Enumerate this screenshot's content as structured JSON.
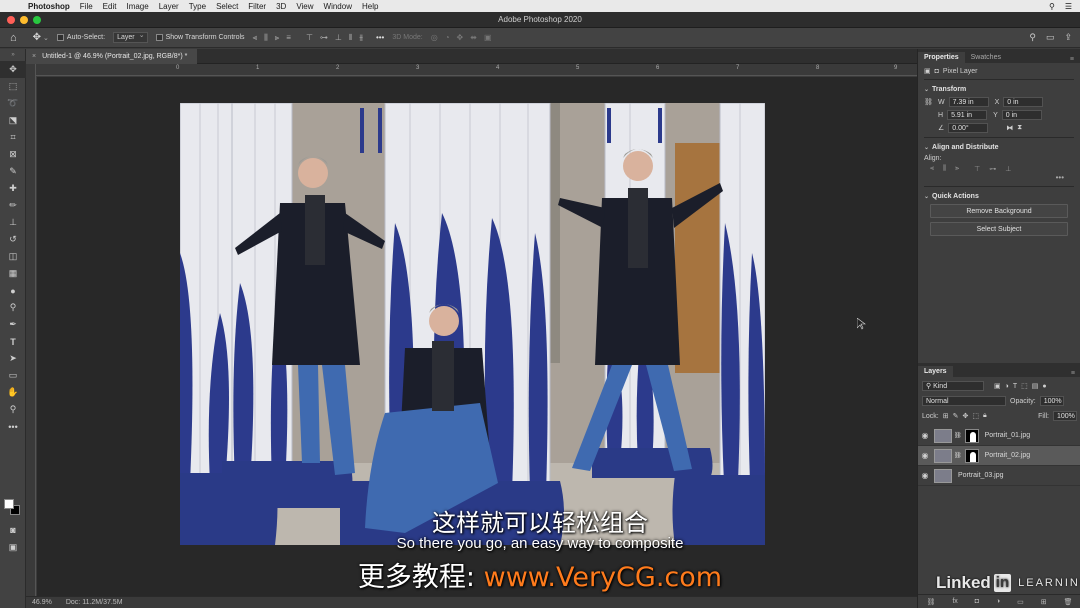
{
  "menubar": {
    "apple": "",
    "app_name": "Photoshop",
    "items": [
      "File",
      "Edit",
      "Image",
      "Layer",
      "Type",
      "Select",
      "Filter",
      "3D",
      "View",
      "Window",
      "Help"
    ]
  },
  "window": {
    "title": "Adobe Photoshop 2020"
  },
  "options_bar": {
    "auto_select_label": "Auto-Select:",
    "auto_select_value": "Layer",
    "transform_controls_label": "Show Transform Controls",
    "mode_3d_label": "3D Mode:",
    "more_label": "•••"
  },
  "document": {
    "tab_title": "Untitled-1 @ 46.9% (Portrait_02.jpg, RGB/8*) *",
    "close_glyph": "×",
    "ruler_marks": [
      "0",
      "1",
      "2",
      "3",
      "4",
      "5",
      "6",
      "7",
      "8",
      "9"
    ]
  },
  "status_bar": {
    "zoom": "46.9%",
    "doc_size": "Doc: 11.2M/37.5M"
  },
  "properties": {
    "tab_properties": "Properties",
    "tab_swatches": "Swatches",
    "layer_type": "Pixel Layer",
    "transform_title": "Transform",
    "w_label": "W",
    "w_value": "7.39 in",
    "h_label": "H",
    "h_value": "5.91 in",
    "x_label": "X",
    "x_value": "0 in",
    "y_label": "Y",
    "y_value": "0 in",
    "angle_value": "0.00°",
    "align_title": "Align and Distribute",
    "align_label": "Align:",
    "quick_actions_title": "Quick Actions",
    "remove_bg_label": "Remove Background",
    "select_subject_label": "Select Subject"
  },
  "layers": {
    "tab_title": "Layers",
    "kind_label": "Kind",
    "blend_mode": "Normal",
    "opacity_label": "Opacity:",
    "opacity_value": "100%",
    "lock_label": "Lock:",
    "fill_label": "Fill:",
    "fill_value": "100%",
    "items": [
      {
        "name": "Portrait_01.jpg"
      },
      {
        "name": "Portrait_02.jpg"
      },
      {
        "name": "Portrait_03.jpg"
      }
    ]
  },
  "subtitles": {
    "chinese": "这样就可以轻松组合",
    "english": "So there you go, an easy way to composite",
    "promo_prefix": "更多教程:",
    "promo_url": "www.VeryCG.com"
  },
  "watermark": {
    "linked": "Linked",
    "in": "in",
    "learning": "LEARNING"
  },
  "colors": {
    "column_blue": "#2c3a8c",
    "column_white": "#e9e9ee",
    "coat": "#1b1e2a",
    "jeans": "#3f6ab0",
    "promo_orange": "#ff7b1c"
  }
}
